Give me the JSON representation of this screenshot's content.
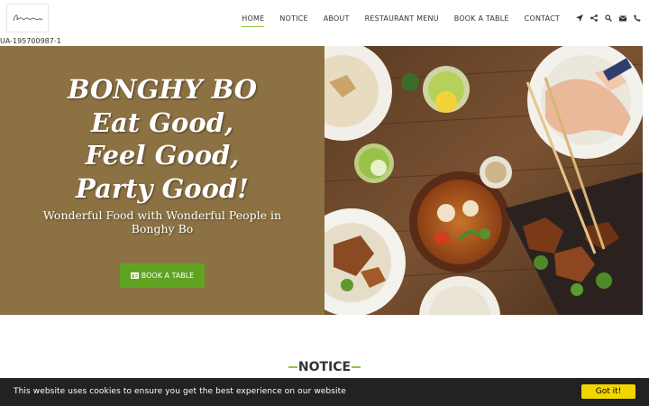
{
  "header": {
    "logo_text": "Bonghy Bo",
    "nav": [
      {
        "label": "HOME",
        "active": true
      },
      {
        "label": "NOTICE",
        "active": false
      },
      {
        "label": "ABOUT",
        "active": false
      },
      {
        "label": "RESTAURANT MENU",
        "active": false
      },
      {
        "label": "BOOK A TABLE",
        "active": false
      },
      {
        "label": "CONTACT",
        "active": false
      }
    ],
    "icons": [
      "location-arrow-icon",
      "share-icon",
      "search-icon",
      "envelope-icon",
      "phone-icon"
    ]
  },
  "tracking_id": "UA-195700987-1",
  "hero": {
    "headline_lines": [
      "BONGHY BO",
      "Eat Good,",
      "Feel Good,",
      "Party Good!"
    ],
    "subtitle": "Wonderful Food with Wonderful People in Bonghy Bo",
    "cta_label": "BOOK A TABLE",
    "image_alt": "Table of plated dishes with chopsticks"
  },
  "notice": {
    "title": "NOTICE"
  },
  "cookie": {
    "message": "This website uses cookies to ensure you get the best experience on our website",
    "button": "Got it!"
  },
  "colors": {
    "accent": "#8ec641",
    "hero_bg": "#8c7143",
    "cta_bg": "#5fa320",
    "cookie_bg": "#222222",
    "cookie_button": "#f1d600"
  }
}
